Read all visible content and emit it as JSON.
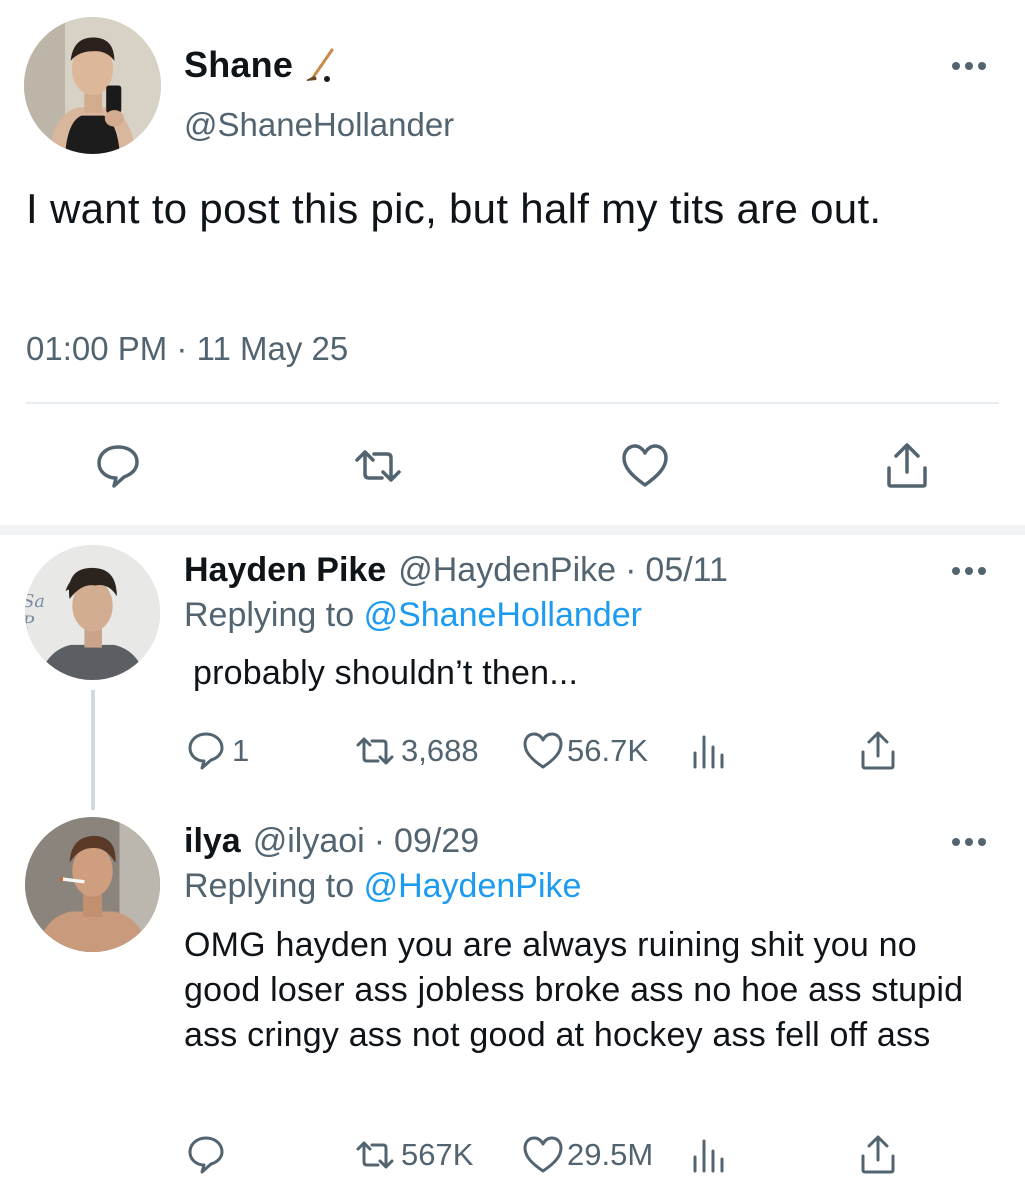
{
  "tweet": {
    "author_name": "Shane",
    "author_handle": "@ShaneHollander",
    "text": "I want to post this pic, but half my tits are out.",
    "time": "01:00 PM",
    "separator": " · ",
    "date": "11 May 25"
  },
  "replies": [
    {
      "name": "Hayden Pike",
      "handle": "@HaydenPike",
      "separator": "·",
      "date": "05/11",
      "replying_prefix": "Replying to",
      "replying_to": "@ShaneHollander",
      "text": "probably shouldn’t then...",
      "stats": {
        "replies": "1",
        "retweets": "3,688",
        "likes": "56.7K"
      },
      "avatar_sign_text": [
        "Sa",
        "P"
      ]
    },
    {
      "name": "ilya",
      "handle": "@ilyaoi",
      "separator": "·",
      "date": "09/29",
      "replying_prefix": "Replying to",
      "replying_to": "@HaydenPike",
      "text": "OMG hayden you are always ruining shit you no good loser ass jobless broke ass no hoe ass stupid ass cringy ass not good at hockey ass fell off ass",
      "stats": {
        "replies": "",
        "retweets": "567K",
        "likes": "29.5M"
      }
    }
  ],
  "icons": {
    "reply": "reply-icon",
    "retweet": "retweet-icon",
    "like": "heart-icon",
    "share": "share-icon",
    "views": "views-icon",
    "more": "more-icon",
    "hockey": "hockey-stick-icon"
  },
  "colors": {
    "text": "#0f1419",
    "secondary": "#536471",
    "link": "#1d9bf0",
    "divider": "#e6ecf0"
  }
}
